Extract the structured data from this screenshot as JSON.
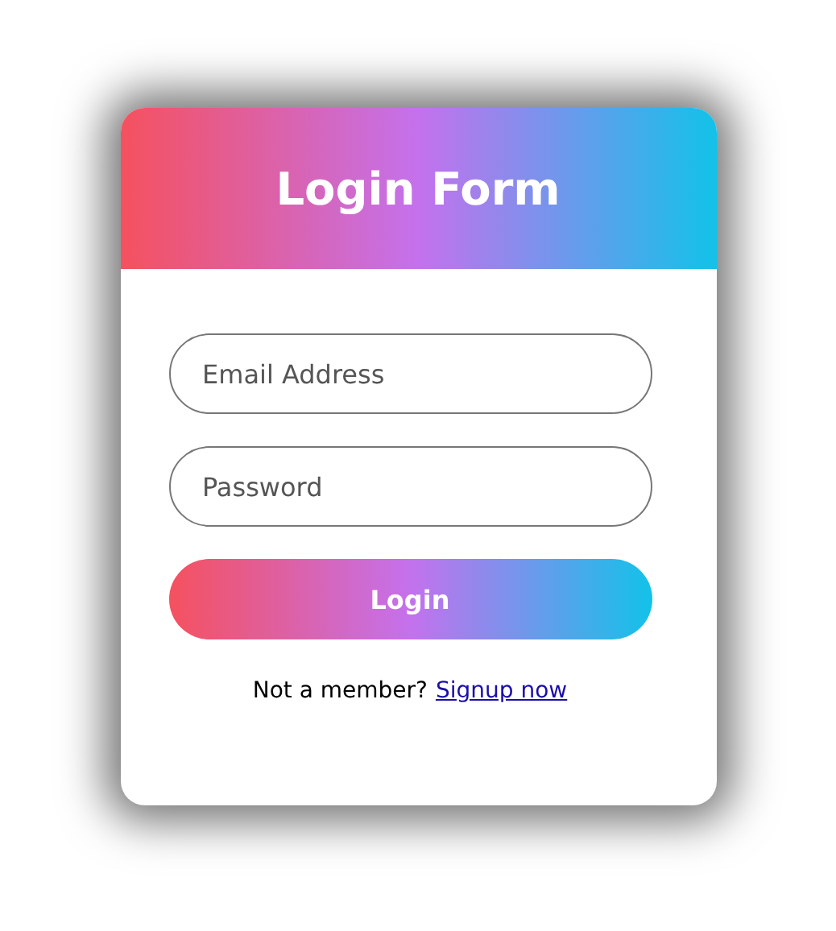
{
  "header": {
    "title": "Login Form"
  },
  "fields": [
    {
      "placeholder": "Email Address"
    },
    {
      "placeholder": "Password"
    }
  ],
  "button": {
    "label": "Login"
  },
  "footer": {
    "text": "Not a member?",
    "link": "Signup now"
  }
}
